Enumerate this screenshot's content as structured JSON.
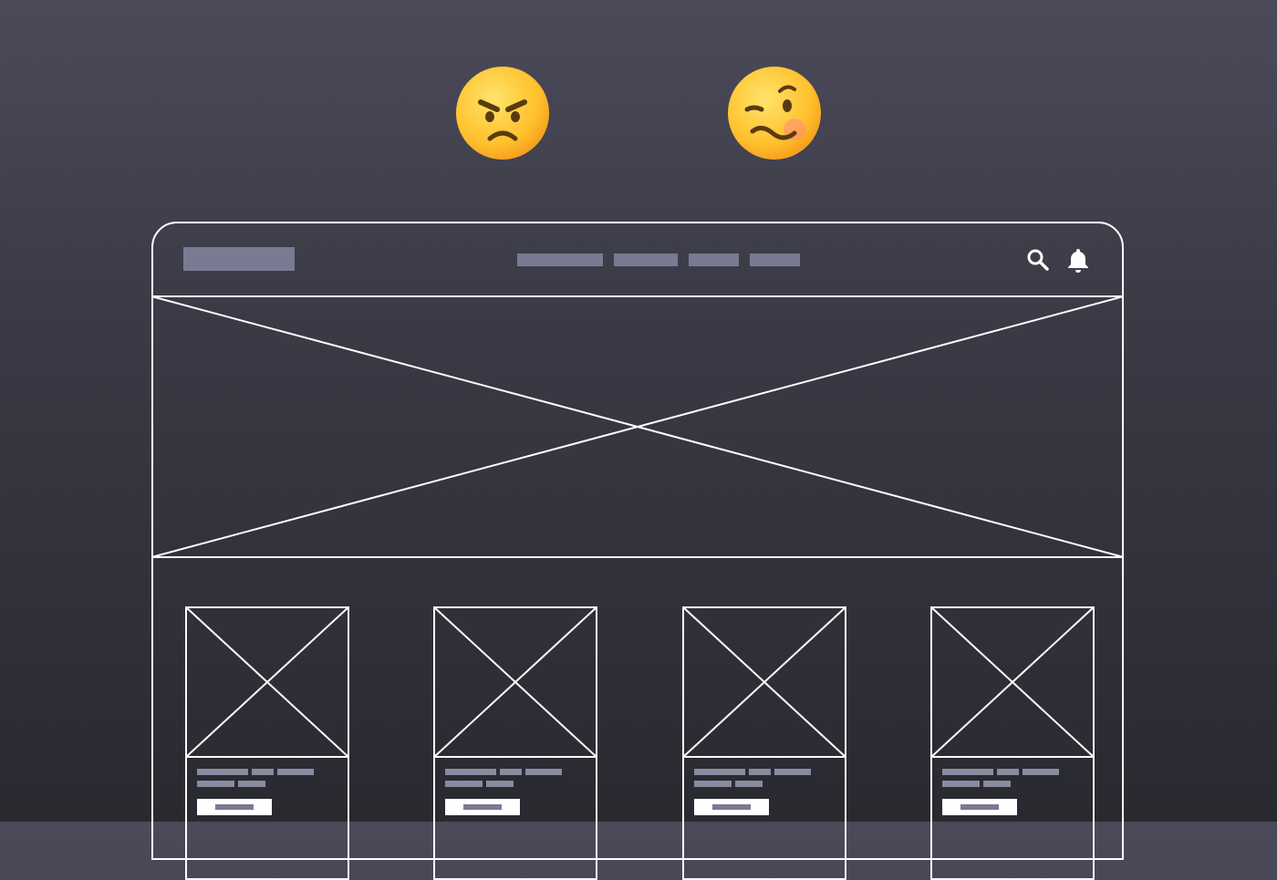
{
  "emojis": [
    {
      "name": "angry-face",
      "face_color": "#ffcc33"
    },
    {
      "name": "woozy-face",
      "face_color": "#ffcc33"
    }
  ],
  "wireframe": {
    "line_color": "#ffffff",
    "placeholder_color": "#7a7a92",
    "header": {
      "logo": "logo-placeholder",
      "nav_items": [
        "nav-placeholder-1",
        "nav-placeholder-2",
        "nav-placeholder-3",
        "nav-placeholder-4"
      ],
      "icons": [
        "search-icon",
        "bell-icon"
      ]
    },
    "hero": "image-placeholder",
    "cards": [
      {
        "image": "image-placeholder",
        "button": "button-placeholder"
      },
      {
        "image": "image-placeholder",
        "button": "button-placeholder"
      },
      {
        "image": "image-placeholder",
        "button": "button-placeholder"
      },
      {
        "image": "image-placeholder",
        "button": "button-placeholder"
      }
    ]
  }
}
